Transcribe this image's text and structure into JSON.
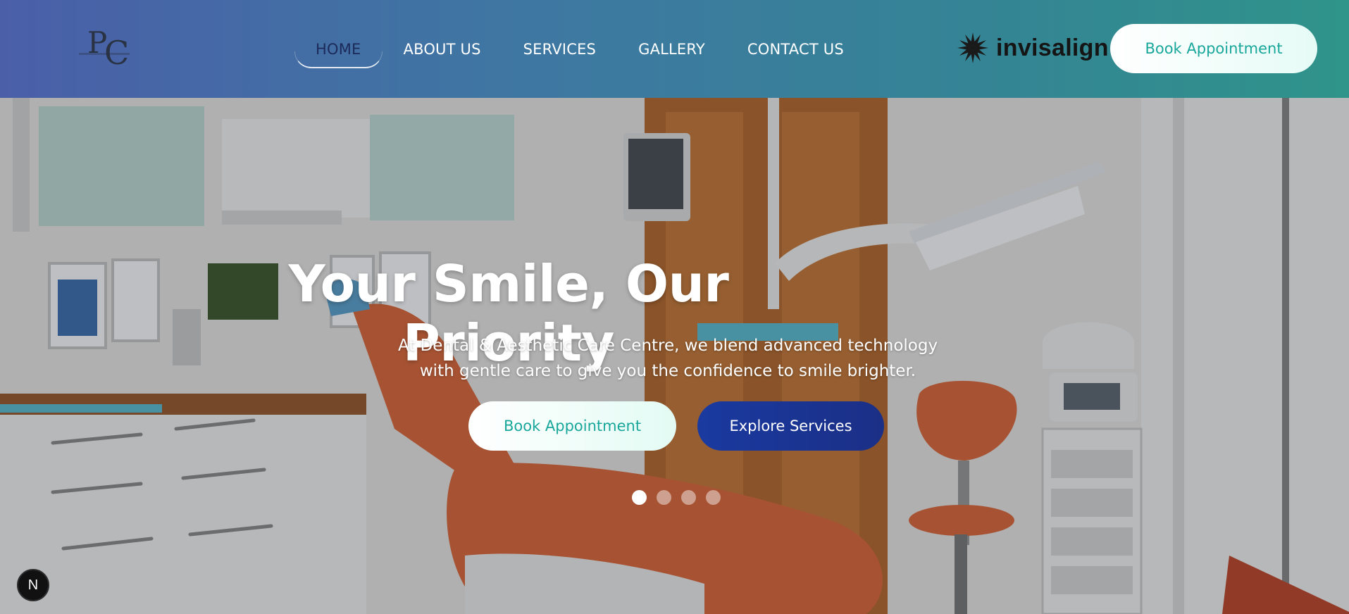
{
  "header": {
    "logo_text": "PC",
    "nav": [
      {
        "label": "HOME",
        "active": true
      },
      {
        "label": "ABOUT US",
        "active": false
      },
      {
        "label": "SERVICES",
        "active": false
      },
      {
        "label": "GALLERY",
        "active": false
      },
      {
        "label": "CONTACT US",
        "active": false
      }
    ],
    "brand": "invisalign",
    "cta_label": "Book Appointment"
  },
  "hero": {
    "title": "Your Smile, Our Priority",
    "subtitle": "At Dental & Aesthetic Care Centre, we blend advanced technology with gentle care to give you the confidence to smile brighter.",
    "primary_label": "Book Appointment",
    "secondary_label": "Explore Services",
    "slides_total": 4,
    "slide_active": 1
  },
  "badge": {
    "label": "N"
  },
  "colors": {
    "header_gradient_start": "#4a5fa8",
    "header_gradient_end": "#2f948a",
    "accent_teal": "#1aa79b",
    "accent_navy": "#1b2f86"
  }
}
